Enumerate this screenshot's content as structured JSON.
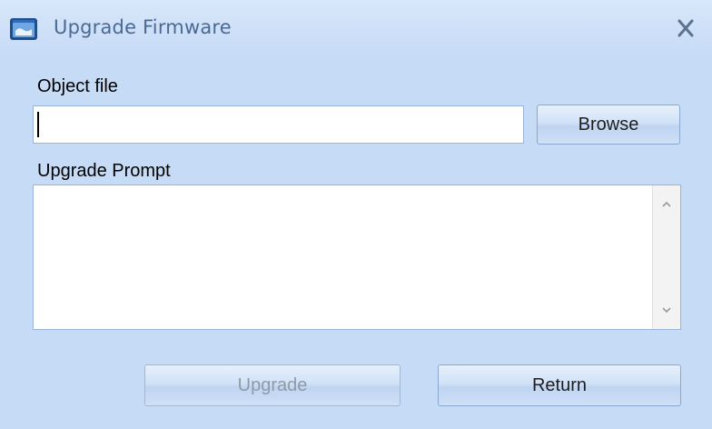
{
  "window": {
    "title": "Upgrade Firmware",
    "app_icon": "app-window-icon",
    "close_icon": "close-icon"
  },
  "object_file": {
    "label": "Object file",
    "value": "",
    "placeholder": ""
  },
  "browse_button": {
    "label": "Browse"
  },
  "upgrade_prompt": {
    "label": "Upgrade Prompt",
    "text": ""
  },
  "buttons": {
    "upgrade_label": "Upgrade",
    "upgrade_enabled": false,
    "return_label": "Return"
  },
  "colors": {
    "dialog_background": "#c6dbf6",
    "title_text": "#4a6a94",
    "disabled_text": "#8f9aa6"
  }
}
